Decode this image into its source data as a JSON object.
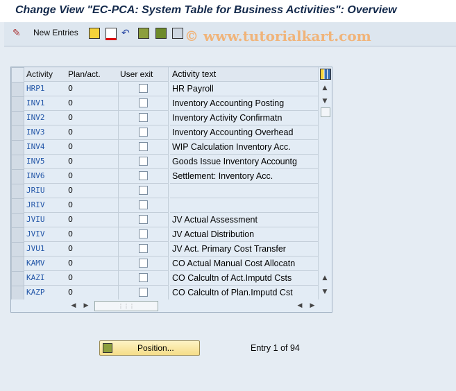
{
  "title": "Change View \"EC-PCA: System Table for Business Activities\": Overview",
  "toolbar": {
    "new_entries": "New Entries",
    "icons": [
      "edit-glasses-icon",
      "copy-icon",
      "delete-icon",
      "undo-icon",
      "select-all-icon",
      "select-block-icon",
      "deselect-all-icon"
    ]
  },
  "watermark": "© www.tutorialkart.com",
  "table": {
    "headers": [
      "Activity",
      "Plan/act.",
      "User exit",
      "Activity text"
    ],
    "rows": [
      {
        "activity": "HRP1",
        "plan": "0",
        "user_exit": false,
        "text": "HR Payroll"
      },
      {
        "activity": "INV1",
        "plan": "0",
        "user_exit": false,
        "text": "Inventory Accounting Posting"
      },
      {
        "activity": "INV2",
        "plan": "0",
        "user_exit": false,
        "text": "Inventory Activity Confirmatn"
      },
      {
        "activity": "INV3",
        "plan": "0",
        "user_exit": false,
        "text": "Inventory Accounting Overhead"
      },
      {
        "activity": "INV4",
        "plan": "0",
        "user_exit": false,
        "text": "WIP Calculation Inventory Acc."
      },
      {
        "activity": "INV5",
        "plan": "0",
        "user_exit": false,
        "text": "Goods Issue Inventory Accountg"
      },
      {
        "activity": "INV6",
        "plan": "0",
        "user_exit": false,
        "text": "Settlement: Inventory Acc."
      },
      {
        "activity": "JRIU",
        "plan": "0",
        "user_exit": false,
        "text": ""
      },
      {
        "activity": "JRIV",
        "plan": "0",
        "user_exit": false,
        "text": ""
      },
      {
        "activity": "JVIU",
        "plan": "0",
        "user_exit": false,
        "text": "JV Actual Assessment"
      },
      {
        "activity": "JVIV",
        "plan": "0",
        "user_exit": false,
        "text": "JV Actual Distribution"
      },
      {
        "activity": "JVU1",
        "plan": "0",
        "user_exit": false,
        "text": "JV Act. Primary Cost Transfer"
      },
      {
        "activity": "KAMV",
        "plan": "0",
        "user_exit": false,
        "text": "CO Actual Manual Cost Allocatn"
      },
      {
        "activity": "KAZI",
        "plan": "0",
        "user_exit": false,
        "text": "CO Calcultn of Act.Imputd Csts"
      },
      {
        "activity": "KAZP",
        "plan": "0",
        "user_exit": false,
        "text": "CO Calcultn of Plan.Imputd Cst"
      }
    ]
  },
  "position_button": "Position...",
  "entry_info": "Entry 1 of 94"
}
